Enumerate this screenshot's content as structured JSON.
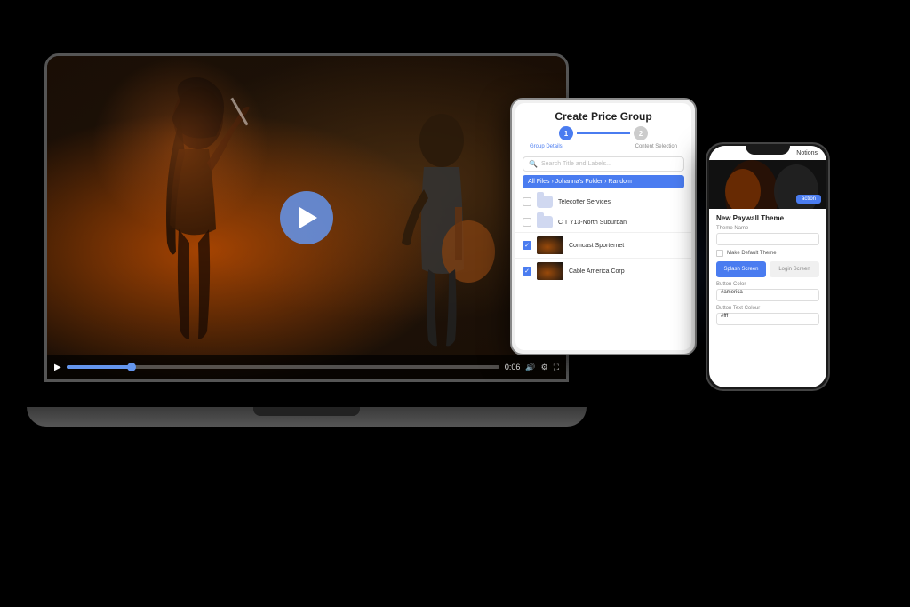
{
  "background": "#000000",
  "laptop": {
    "video": {
      "play_button_label": "▶",
      "time_current": "0:06",
      "time_total": "0:06",
      "progress_percent": 15
    },
    "controls": {
      "play": "▶",
      "volume": "🔊",
      "fullscreen": "⛶"
    }
  },
  "tablet": {
    "title": "Create Price Group",
    "steps": [
      {
        "id": 1,
        "label": "Group Details",
        "active": true
      },
      {
        "id": 2,
        "label": "Content Selection",
        "active": false
      }
    ],
    "search_placeholder": "Search Title and Labels...",
    "breadcrumb": "All Files › Johanna's Folder › Random",
    "rows": [
      {
        "type": "folder",
        "name": "Telecoffer Services",
        "checked": false
      },
      {
        "type": "folder",
        "name": "C T Y13-North Suburban",
        "checked": false
      },
      {
        "type": "video",
        "name": "Comcast Sporternet",
        "checked": true
      },
      {
        "type": "video",
        "name": "Cable America Corp",
        "checked": true
      }
    ]
  },
  "phone": {
    "status": "Notch",
    "header_label": "Notions",
    "section_title": "New Paywall Theme",
    "fields": [
      {
        "label": "Theme Name",
        "value": ""
      },
      {
        "label": "Make Default Theme",
        "type": "checkbox"
      }
    ],
    "toggle_buttons": [
      {
        "label": "Splash Screen",
        "active": true
      },
      {
        "label": "Login Screen",
        "active": false
      }
    ],
    "color_section": {
      "label": "Button Color",
      "value": "#america"
    },
    "text_color_section": {
      "label": "Button Text Colour",
      "value": "#fff"
    }
  }
}
